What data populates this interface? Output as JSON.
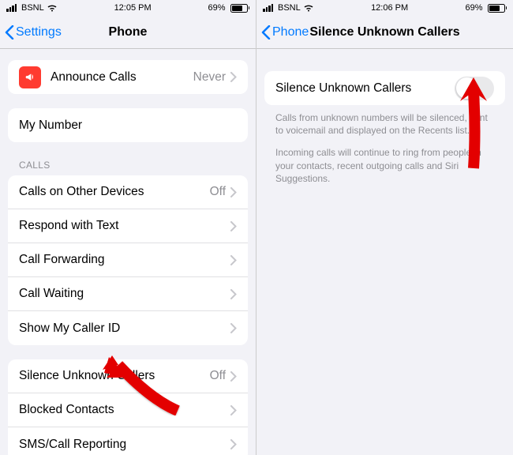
{
  "left": {
    "status": {
      "carrier": "BSNL",
      "time": "12:05 PM",
      "battery": "69%"
    },
    "nav": {
      "back": "Settings",
      "title": "Phone"
    },
    "announce": {
      "label": "Announce Calls",
      "value": "Never"
    },
    "mynumber": {
      "label": "My Number"
    },
    "callsHeader": "CALLS",
    "calls": [
      {
        "label": "Calls on Other Devices",
        "value": "Off"
      },
      {
        "label": "Respond with Text",
        "value": ""
      },
      {
        "label": "Call Forwarding",
        "value": ""
      },
      {
        "label": "Call Waiting",
        "value": ""
      },
      {
        "label": "Show My Caller ID",
        "value": ""
      }
    ],
    "silence": [
      {
        "label": "Silence Unknown Callers",
        "value": "Off"
      },
      {
        "label": "Blocked Contacts",
        "value": ""
      },
      {
        "label": "SMS/Call Reporting",
        "value": ""
      }
    ]
  },
  "right": {
    "status": {
      "carrier": "BSNL",
      "time": "12:06 PM",
      "battery": "69%"
    },
    "nav": {
      "back": "Phone",
      "title": "Silence Unknown Callers"
    },
    "toggle": {
      "label": "Silence Unknown Callers"
    },
    "desc1": "Calls from unknown numbers will be silenced, sent to voicemail and displayed on the Recents list.",
    "desc2": "Incoming calls will continue to ring from people in your contacts, recent outgoing calls and Siri Suggestions."
  }
}
